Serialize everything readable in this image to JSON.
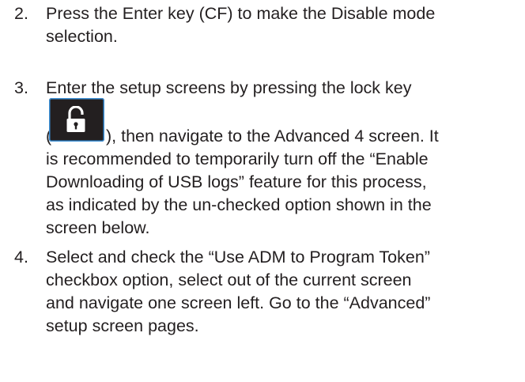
{
  "steps": [
    {
      "number": "2.",
      "lines": [
        "Press the Enter key (CF) to make the Disable mode",
        "selection."
      ]
    },
    {
      "number": "3.",
      "line_before_icon": "Enter the setup screens by pressing the lock key",
      "paren_open": "(",
      "icon": "lock-key-icon",
      "line_after_icon": "), then navigate to the Advanced 4 screen. It",
      "lines": [
        "is recommended to temporarily turn off the “Enable",
        "Downloading of USB logs” feature for this process,",
        "as indicated by the un-checked option shown in the",
        "screen below."
      ]
    },
    {
      "number": "4.",
      "lines": [
        "Select and check the “Use ADM to Program Token”",
        "checkbox option, select out of the current screen",
        "and navigate one screen left. Go to the “Advanced”",
        "setup screen pages."
      ]
    }
  ],
  "colors": {
    "text": "#231f20",
    "key_background": "#231f20",
    "key_border": "#3b8fd6",
    "key_glyph": "#ffffff"
  }
}
